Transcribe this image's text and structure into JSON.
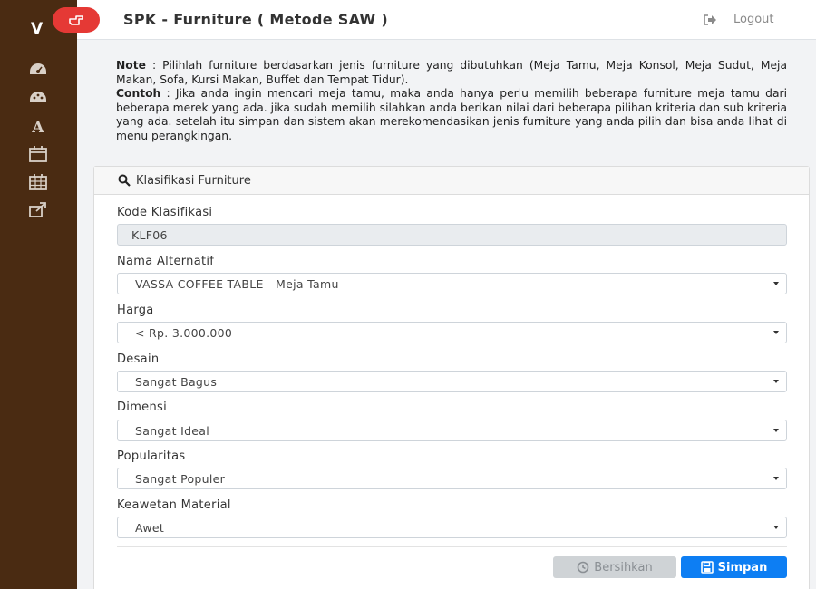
{
  "sidebar": {
    "brand": "V",
    "items": [
      {
        "icon": "dashboard-icon"
      },
      {
        "icon": "palette-icon"
      },
      {
        "icon": "font-icon"
      },
      {
        "icon": "calendar-icon"
      },
      {
        "icon": "calendar-grid-icon"
      },
      {
        "icon": "external-link-icon"
      }
    ],
    "color": "#4a2b12"
  },
  "header": {
    "title": "SPK - Furniture ( Metode SAW )",
    "logout_label": "Logout",
    "toggle_color": "#e53935"
  },
  "note": {
    "note_label": "Note",
    "note_text": " : Pilihlah furniture berdasarkan jenis furniture yang dibutuhkan (Meja Tamu, Meja Konsol, Meja Sudut, Meja Makan, Sofa, Kursi Makan, Buffet dan Tempat Tidur).",
    "example_label": "Contoh",
    "example_text": " : Jika anda ingin mencari meja tamu, maka anda hanya perlu memilih beberapa furniture meja tamu dari beberapa merek yang ada. jika sudah memilih silahkan anda berikan nilai dari beberapa pilihan kriteria dan sub kriteria yang ada. setelah itu simpan dan sistem akan merekomendasikan jenis furniture yang anda pilih dan bisa anda lihat di menu perangkingan."
  },
  "card": {
    "title": "Klasifikasi Furniture"
  },
  "form": {
    "kode_label": "Kode Klasifikasi",
    "kode_value": "KLF06",
    "alternatif_label": "Nama Alternatif",
    "alternatif_value": "VASSA COFFEE TABLE - Meja Tamu",
    "harga_label": "Harga",
    "harga_value": "< Rp. 3.000.000",
    "desain_label": "Desain",
    "desain_value": "Sangat Bagus",
    "dimensi_label": "Dimensi",
    "dimensi_value": "Sangat Ideal",
    "popularitas_label": "Popularitas",
    "popularitas_value": "Sangat Populer",
    "keawetan_label": "Keawetan Material",
    "keawetan_value": "Awet"
  },
  "buttons": {
    "clear_label": "Bersihkan",
    "save_label": "Simpan",
    "save_color": "#0d7ef3"
  }
}
